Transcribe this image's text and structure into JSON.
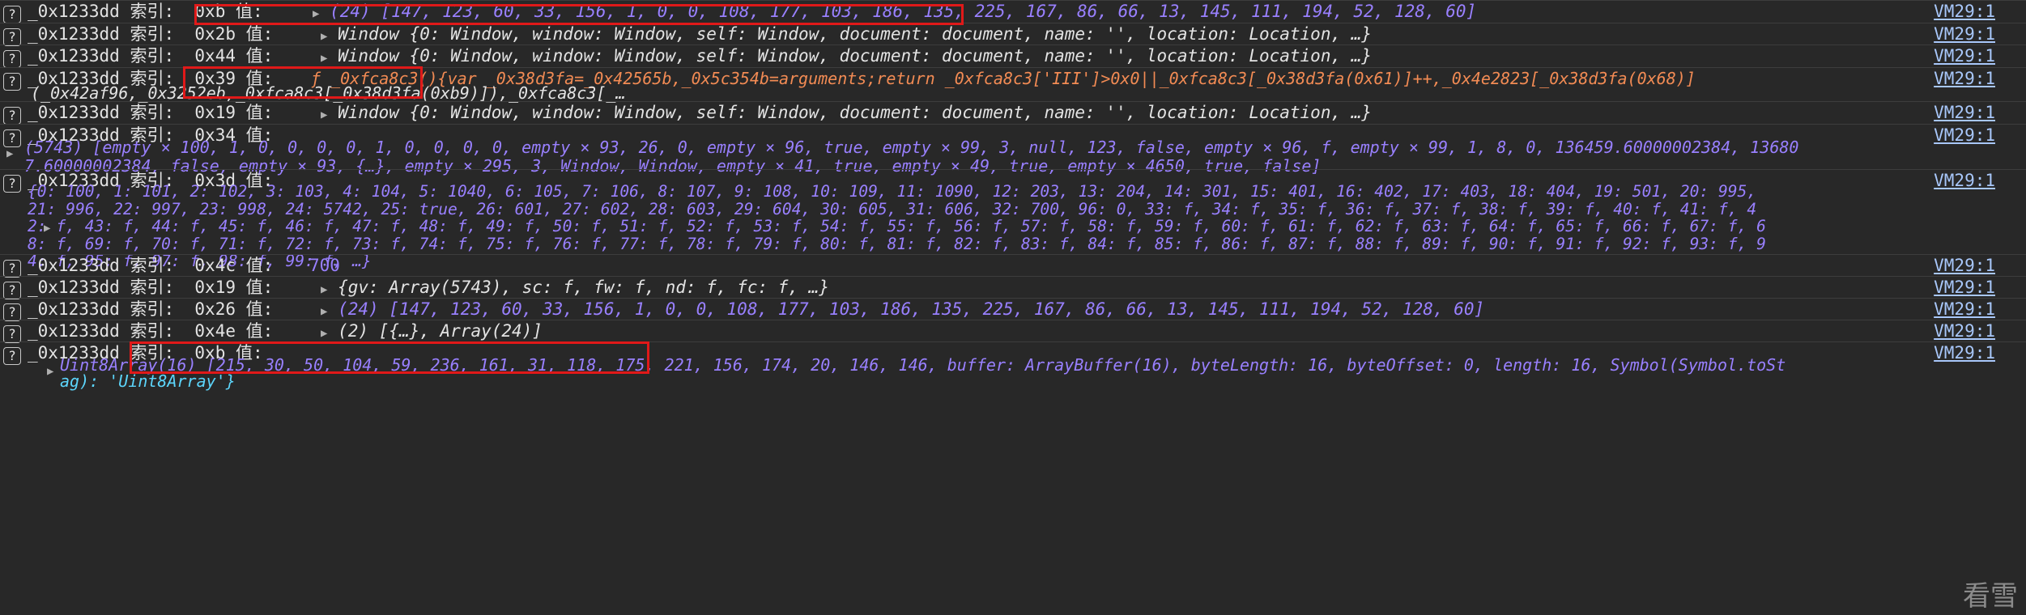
{
  "source_link": "VM29:1",
  "prefix": "_0x1233dd",
  "index_label": "索引:",
  "value_label": "值:",
  "rows": [
    {
      "idx": "0xb",
      "value": "(24) [147, 123, 60, 33, 156, 1, 0, 0, 108, 177, 103, 186, 135, 225, 167, 86, 66, 13, 145, 111, 194, 52, 128, 60]"
    },
    {
      "idx": "0x2b",
      "value": "Window {0: Window, window: Window, self: Window, document: document, name: '', location: Location, …}"
    },
    {
      "idx": "0x44",
      "value": "Window {0: Window, window: Window, self: Window, document: document, name: '', location: Location, …}"
    },
    {
      "idx": "0x39",
      "value": "ƒ _0xfca8c3(){var _0x38d3fa=_0x42565b,_0x5c354b=arguments;return _0xfca8c3['III']>0x0||_0xfca8c3[_0x38d3fa(0x61)]++,_0x4e2823[_0x38d3fa(0x68)]",
      "value2": "(_0x42af96,_0x3252eb,_0xfca8c3[_0x38d3fa(0xb9)]),_0xfca8c3[_…"
    },
    {
      "idx": "0x19",
      "value": "Window {0: Window, window: Window, self: Window, document: document, name: '', location: Location, …}"
    },
    {
      "idx": "0x34",
      "value2": "(5743) [empty × 100, 1, 0, 0, 0, 0, 1, 0, 0, 0, 0, empty × 93, 26, 0, empty × 96, true, empty × 99, 3, null, 123, false, empty × 96, f, empty × 99, 1, 8, 0, 136459.60000002384, 13680",
      "value3": "7.60000002384, false, empty × 93, {…}, empty × 295, 3, Window, Window, empty × 41, true, empty × 49, true, empty × 4650, true, false]"
    },
    {
      "idx": "0x3d",
      "lines": [
        "{0: 100, 1: 101, 2: 102, 3: 103, 4: 104, 5: 1040, 6: 105, 7: 106, 8: 107, 9: 108, 10: 109, 11: 1090, 12: 203, 13: 204, 14: 301, 15: 401, 16: 402, 17: 403, 18: 404, 19: 501, 20: 995,",
        "21: 996, 22: 997, 23: 998, 24: 5742, 25: true, 26: 601, 27: 602, 28: 603, 29: 604, 30: 605, 31: 606, 32: 700, 96: 0, 33: f, 34: f, 35: f, 36: f, 37: f, 38: f, 39: f, 40: f, 41: f, 4",
        "2: f, 43: f, 44: f, 45: f, 46: f, 47: f, 48: f, 49: f, 50: f, 51: f, 52: f, 53: f, 54: f, 55: f, 56: f, 57: f, 58: f, 59: f, 60: f, 61: f, 62: f, 63: f, 64: f, 65: f, 66: f, 67: f, 6",
        "8: f, 69: f, 70: f, 71: f, 72: f, 73: f, 74: f, 75: f, 76: f, 77: f, 78: f, 79: f, 80: f, 81: f, 82: f, 83: f, 84: f, 85: f, 86: f, 87: f, 88: f, 89: f, 90: f, 91: f, 92: f, 93: f, 9",
        "4: f, 95: f, 97: f, 98: f, 99: f, …}"
      ]
    },
    {
      "idx": "0x4c",
      "value": "700"
    },
    {
      "idx": "0x19",
      "value": "{gv: Array(5743), sc: f, fw: f, nd: f, fc: f, …}"
    },
    {
      "idx": "0x26",
      "value": "(24) [147, 123, 60, 33, 156, 1, 0, 0, 108, 177, 103, 186, 135, 225, 167, 86, 66, 13, 145, 111, 194, 52, 128, 60]"
    },
    {
      "idx": "0x4e",
      "value": "(2) [{…}, Array(24)]"
    },
    {
      "idx": "0xb",
      "value2": "Uint8Array(16) [215, 30, 50, 104, 59, 236, 161, 31, 118, 175, 221, 156, 174, 20, 146, 146, buffer: ArrayBuffer(16), byteLength: 16, byteOffset: 0, length: 16, Symbol(Symbol.toSt",
      "value3": "ag): 'Uint8Array'}"
    }
  ],
  "watermark": "看雪"
}
